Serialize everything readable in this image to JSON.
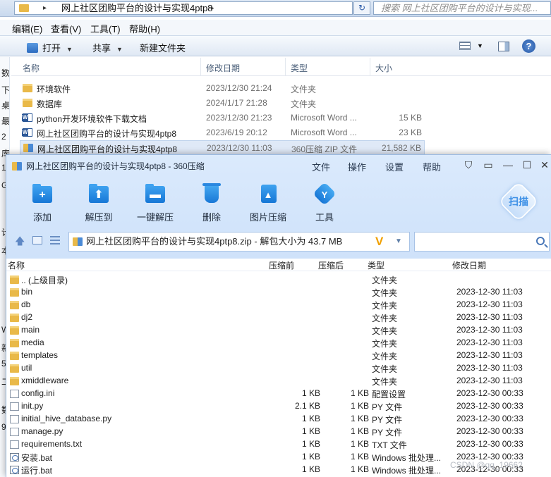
{
  "explorer": {
    "address": {
      "crumb": "网上社区团购平台的设计与实现4ptp8",
      "search_placeholder": "搜索 网上社区团购平台的设计与实现..."
    },
    "menu": [
      "编辑(E)",
      "查看(V)",
      "工具(T)",
      "帮助(H)"
    ],
    "toolbar": {
      "open": "打开",
      "share": "共享",
      "new_folder": "新建文件夹"
    },
    "left_nav_fragments": [
      "数",
      "下",
      "桌",
      "最",
      "2",
      "库",
      "1",
      "G",
      "计",
      "本",
      "W",
      "新",
      "5",
      "二",
      "数",
      "9"
    ],
    "columns": {
      "name": "名称",
      "date": "修改日期",
      "type": "类型",
      "size": "大小"
    },
    "files": [
      {
        "icon": "folder",
        "name": "环境软件",
        "date": "2023/12/30 21:24",
        "type": "文件夹",
        "size": ""
      },
      {
        "icon": "folder",
        "name": "数据库",
        "date": "2024/1/17 21:28",
        "type": "文件夹",
        "size": ""
      },
      {
        "icon": "word",
        "name": "python开发环境软件下载文档",
        "date": "2023/12/30 21:23",
        "type": "Microsoft Word ...",
        "size": "15 KB"
      },
      {
        "icon": "word",
        "name": "网上社区团购平台的设计与实现4ptp8",
        "date": "2023/6/19 20:12",
        "type": "Microsoft Word ...",
        "size": "23 KB"
      },
      {
        "icon": "zip",
        "name": "网上社区团购平台的设计与实现4ptp8",
        "date": "2023/12/30 11:03",
        "type": "360压缩 ZIP 文件",
        "size": "21,582 KB",
        "selected": true
      }
    ]
  },
  "zip": {
    "title": "网上社区团购平台的设计与实现4ptp8 - 360压缩",
    "menu": [
      "文件",
      "操作",
      "设置",
      "帮助"
    ],
    "tools": [
      "添加",
      "解压到",
      "一键解压",
      "删除",
      "图片压缩",
      "工具"
    ],
    "scan_badge": "扫描",
    "path": "网上社区团购平台的设计与实现4ptp8.zip - 解包大小为 43.7 MB",
    "columns": {
      "name": "名称",
      "compressed": "压缩前",
      "uncompressed": "压缩后",
      "type": "类型",
      "modified": "修改日期"
    },
    "rows": [
      {
        "icon": "folder",
        "name": ".. (上级目录)",
        "compressed": "",
        "uncompressed": "",
        "type": "文件夹",
        "modified": ""
      },
      {
        "icon": "folder",
        "name": "bin",
        "compressed": "",
        "uncompressed": "",
        "type": "文件夹",
        "modified": "2023-12-30 11:03"
      },
      {
        "icon": "folder",
        "name": "db",
        "compressed": "",
        "uncompressed": "",
        "type": "文件夹",
        "modified": "2023-12-30 11:03"
      },
      {
        "icon": "folder",
        "name": "dj2",
        "compressed": "",
        "uncompressed": "",
        "type": "文件夹",
        "modified": "2023-12-30 11:03"
      },
      {
        "icon": "folder",
        "name": "main",
        "compressed": "",
        "uncompressed": "",
        "type": "文件夹",
        "modified": "2023-12-30 11:03"
      },
      {
        "icon": "folder",
        "name": "media",
        "compressed": "",
        "uncompressed": "",
        "type": "文件夹",
        "modified": "2023-12-30 11:03"
      },
      {
        "icon": "folder",
        "name": "templates",
        "compressed": "",
        "uncompressed": "",
        "type": "文件夹",
        "modified": "2023-12-30 11:03"
      },
      {
        "icon": "folder",
        "name": "util",
        "compressed": "",
        "uncompressed": "",
        "type": "文件夹",
        "modified": "2023-12-30 11:03"
      },
      {
        "icon": "folder",
        "name": "xmiddleware",
        "compressed": "",
        "uncompressed": "",
        "type": "文件夹",
        "modified": "2023-12-30 11:03"
      },
      {
        "icon": "file",
        "name": "config.ini",
        "compressed": "1 KB",
        "uncompressed": "1 KB",
        "type": "配置设置",
        "modified": "2023-12-30 00:33"
      },
      {
        "icon": "file",
        "name": "init.py",
        "compressed": "2.1 KB",
        "uncompressed": "1 KB",
        "type": "PY 文件",
        "modified": "2023-12-30 00:33"
      },
      {
        "icon": "file",
        "name": "initial_hive_database.py",
        "compressed": "1 KB",
        "uncompressed": "1 KB",
        "type": "PY 文件",
        "modified": "2023-12-30 00:33"
      },
      {
        "icon": "file",
        "name": "manage.py",
        "compressed": "1 KB",
        "uncompressed": "1 KB",
        "type": "PY 文件",
        "modified": "2023-12-30 00:33"
      },
      {
        "icon": "file",
        "name": "requirements.txt",
        "compressed": "1 KB",
        "uncompressed": "1 KB",
        "type": "TXT 文件",
        "modified": "2023-12-30 00:33"
      },
      {
        "icon": "bat",
        "name": "安装.bat",
        "compressed": "1 KB",
        "uncompressed": "1 KB",
        "type": "Windows 批处理...",
        "modified": "2023-12-30 00:33"
      },
      {
        "icon": "bat",
        "name": "运行.bat",
        "compressed": "1 KB",
        "uncompressed": "1 KB",
        "type": "Windows 批处理...",
        "modified": "2023-12-30 00:33"
      }
    ]
  },
  "watermark": "CSDN @qq_19662"
}
